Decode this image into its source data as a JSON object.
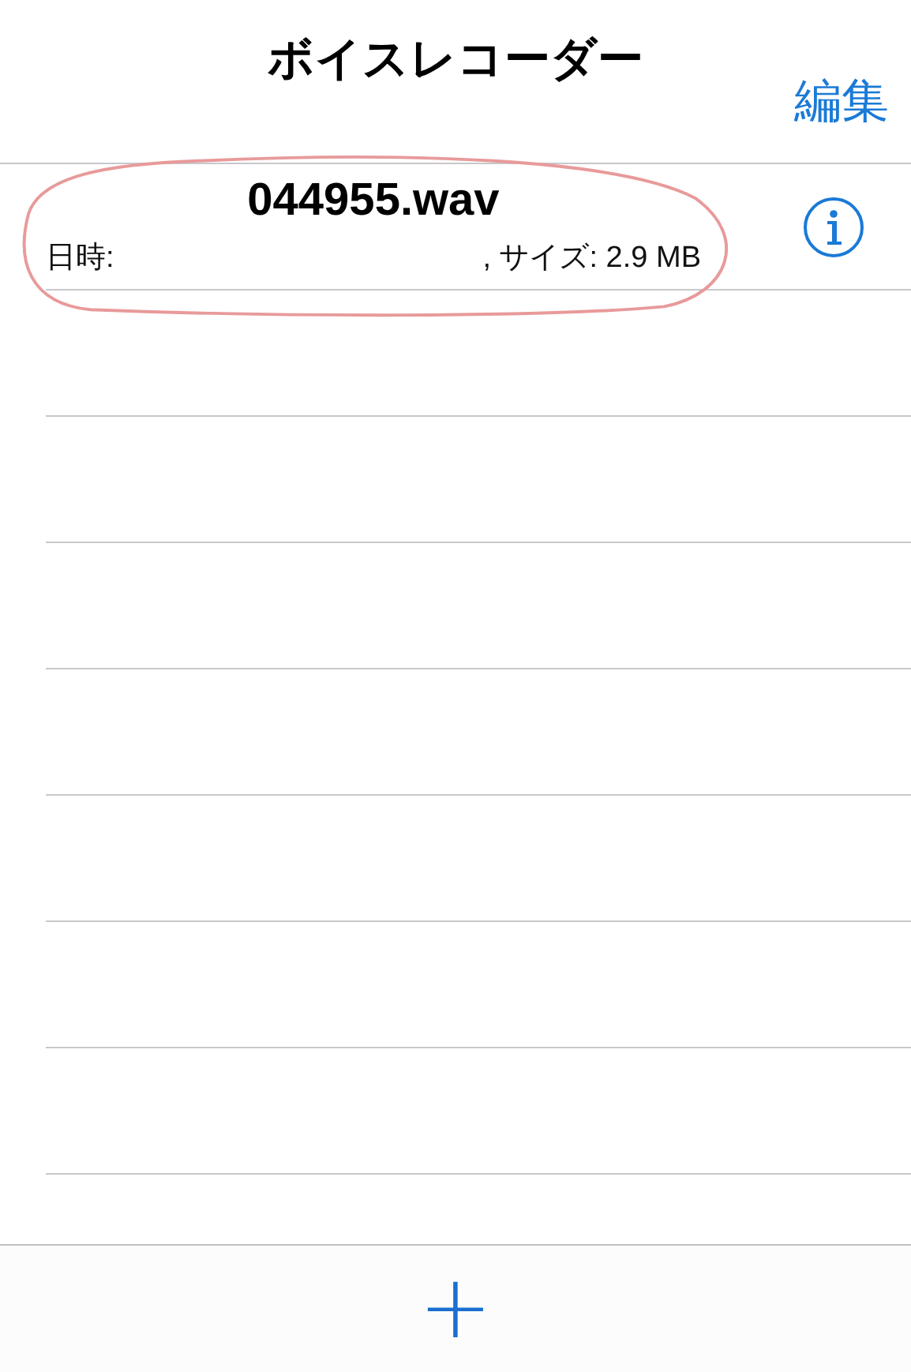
{
  "nav_bar": {
    "title": "ボイスレコーダー",
    "edit_button": "編集"
  },
  "recordings": [
    {
      "name": "044955.wav",
      "date_label": "日時:",
      "size_text": ", サイズ: 2.9 MB"
    }
  ],
  "toolbar": {
    "add_button": "+"
  }
}
